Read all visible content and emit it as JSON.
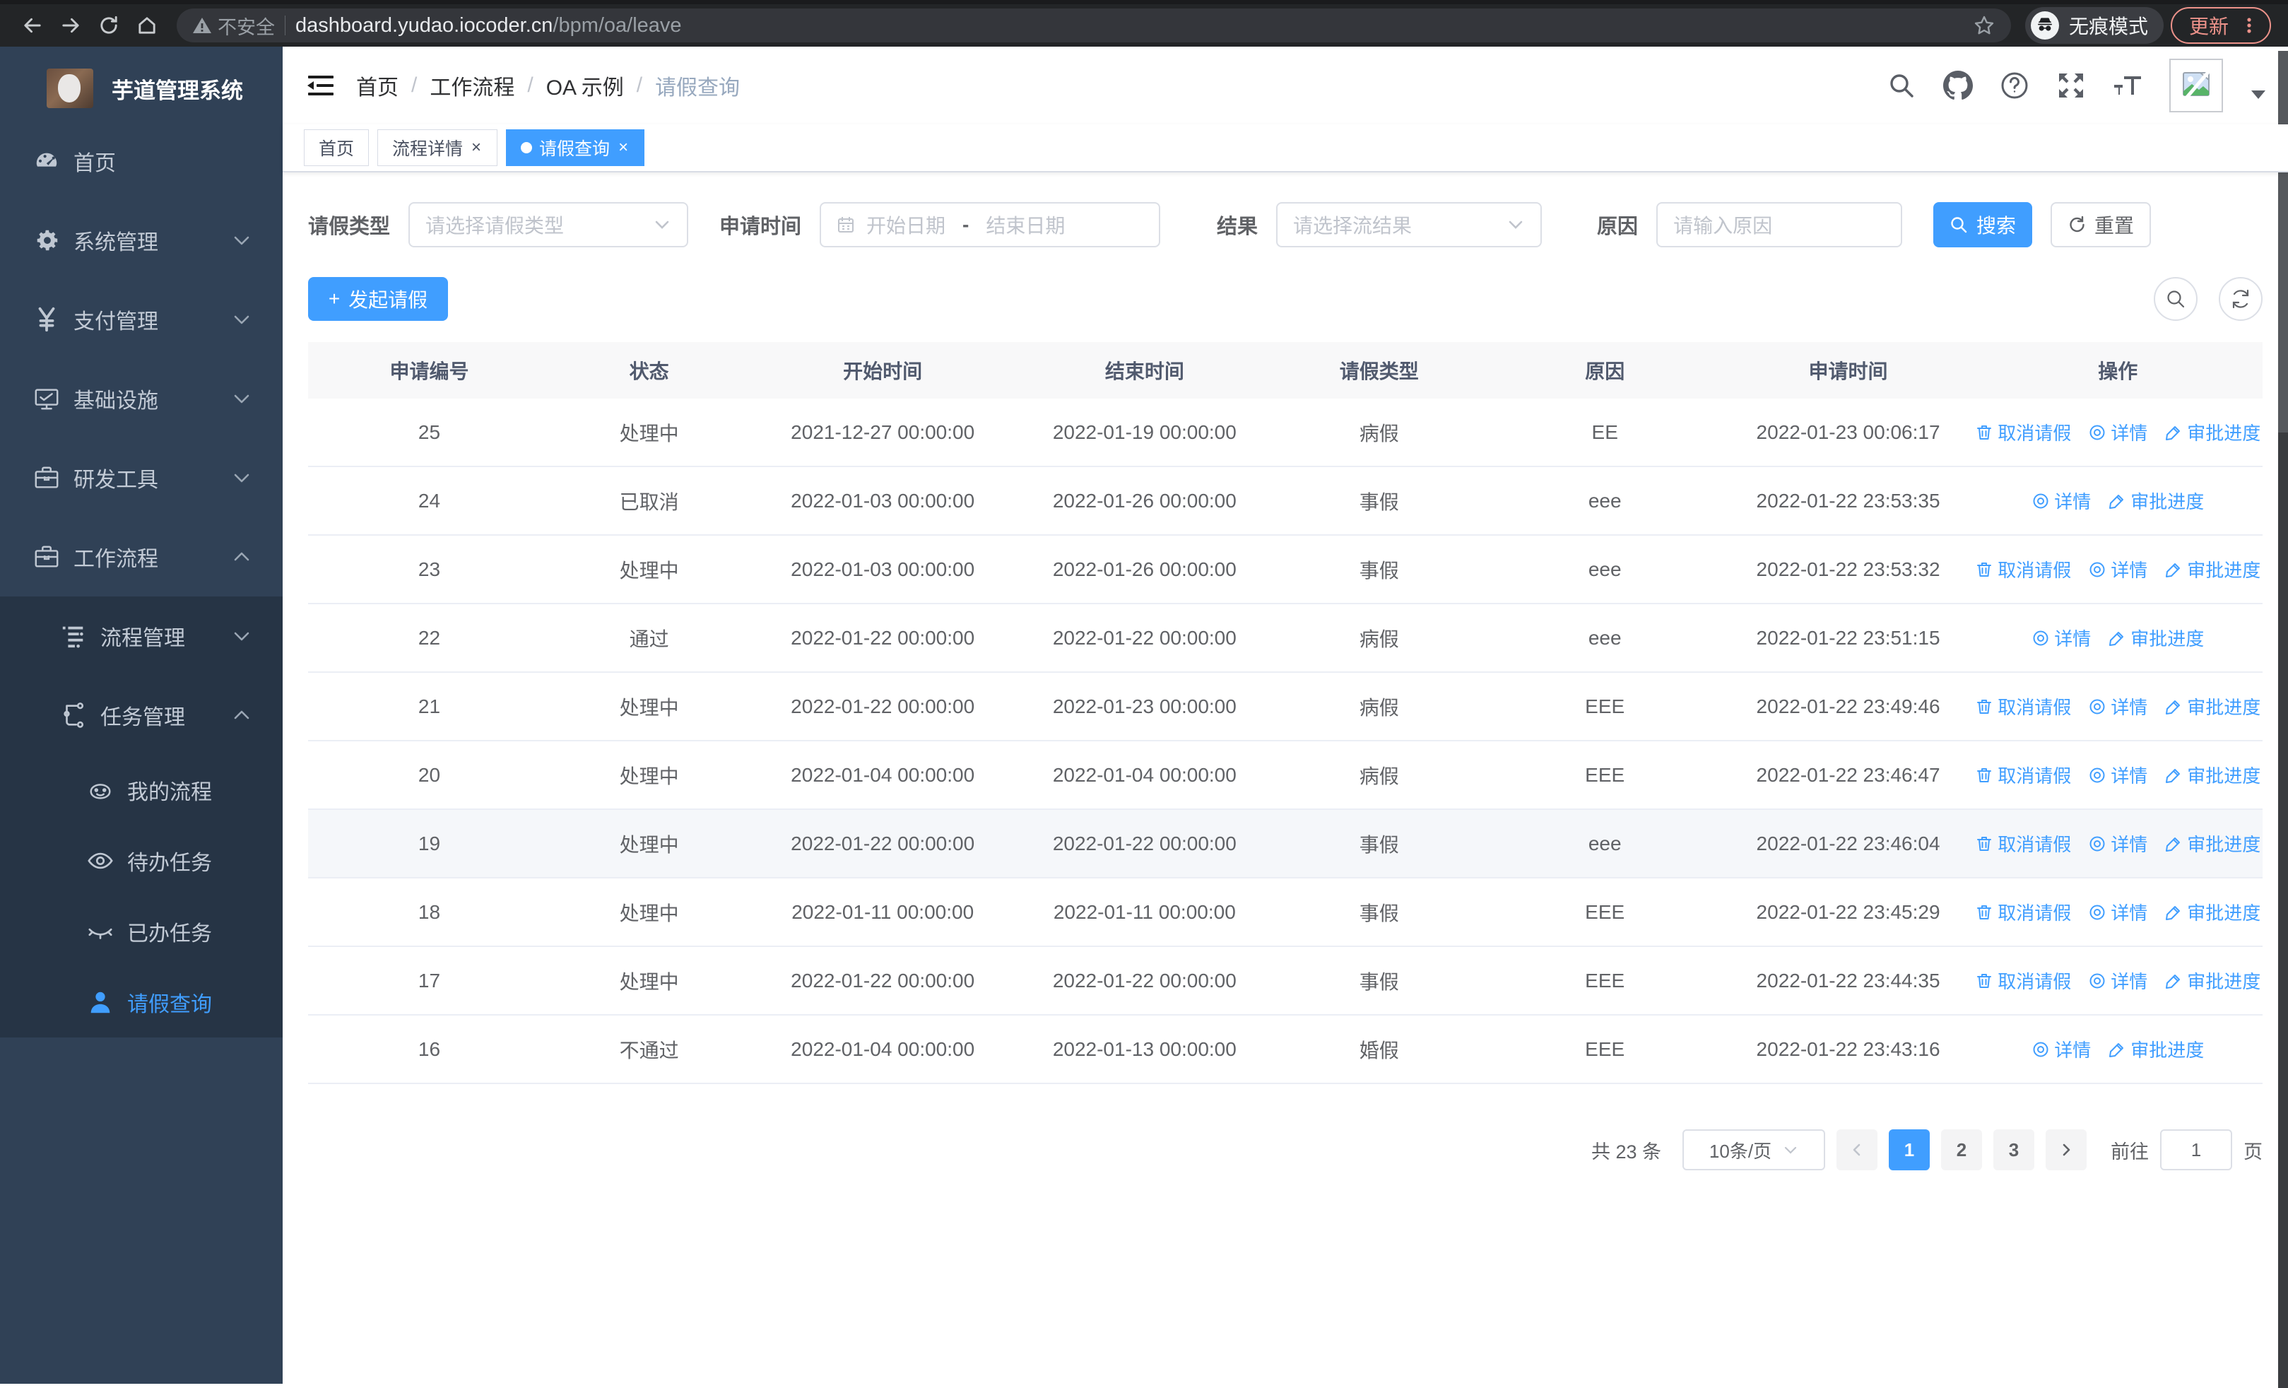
{
  "colors": {
    "accent": "#409eff",
    "sidebar_bg": "#304156",
    "submenu_bg": "#263445",
    "danger_chip": "#ec928a"
  },
  "browser": {
    "security_label": "不安全",
    "url_host": "dashboard.yudao.iocoder.cn",
    "url_path": "/bpm/oa/leave",
    "incognito_label": "无痕模式",
    "update_label": "更新"
  },
  "sidebar": {
    "title": "芋道管理系统",
    "menu": [
      {
        "name": "home",
        "label": "首页",
        "icon": "gauge",
        "level": 1,
        "arrow": "",
        "active": false
      },
      {
        "name": "system-mgmt",
        "label": "系统管理",
        "icon": "gear",
        "level": 1,
        "arrow": "down",
        "active": false
      },
      {
        "name": "payment-mgmt",
        "label": "支付管理",
        "icon": "yen",
        "level": 1,
        "arrow": "down",
        "active": false
      },
      {
        "name": "infrastructure",
        "label": "基础设施",
        "icon": "monitor",
        "level": 1,
        "arrow": "down",
        "active": false
      },
      {
        "name": "dev-tools",
        "label": "研发工具",
        "icon": "briefcase",
        "level": 1,
        "arrow": "down",
        "active": false
      },
      {
        "name": "workflow",
        "label": "工作流程",
        "icon": "briefcase",
        "level": 1,
        "arrow": "up",
        "active": false
      },
      {
        "name": "process-mgmt",
        "label": "流程管理",
        "icon": "list",
        "level": 2,
        "arrow": "down",
        "active": false
      },
      {
        "name": "task-mgmt",
        "label": "任务管理",
        "icon": "flow",
        "level": 2,
        "arrow": "up",
        "active": false
      },
      {
        "name": "my-process",
        "label": "我的流程",
        "icon": "robot",
        "level": 3,
        "arrow": "",
        "active": false
      },
      {
        "name": "todo-tasks",
        "label": "待办任务",
        "icon": "eye-open",
        "level": 3,
        "arrow": "",
        "active": false
      },
      {
        "name": "done-tasks",
        "label": "已办任务",
        "icon": "eye-closed",
        "level": 3,
        "arrow": "",
        "active": false
      },
      {
        "name": "leave-query",
        "label": "请假查询",
        "icon": "user",
        "level": 3,
        "arrow": "",
        "active": true
      }
    ]
  },
  "header": {
    "breadcrumb": [
      "首页",
      "工作流程",
      "OA 示例",
      "请假查询"
    ]
  },
  "tabs": [
    {
      "name": "home",
      "label": "首页",
      "closable": false,
      "active": false
    },
    {
      "name": "process-detail",
      "label": "流程详情",
      "closable": true,
      "active": false
    },
    {
      "name": "leave-query",
      "label": "请假查询",
      "closable": true,
      "active": true
    }
  ],
  "filters": {
    "leave_type_label": "请假类型",
    "leave_type_placeholder": "请选择请假类型",
    "apply_time_label": "申请时间",
    "start_date_placeholder": "开始日期",
    "range_separator": "-",
    "end_date_placeholder": "结束日期",
    "result_label": "结果",
    "result_placeholder": "请选择流结果",
    "reason_label": "原因",
    "reason_placeholder": "请输入原因",
    "search_label": "搜索",
    "reset_label": "重置"
  },
  "toolbar": {
    "create_label": "发起请假",
    "plus_sign": "+"
  },
  "table": {
    "columns": [
      "申请编号",
      "状态",
      "开始时间",
      "结束时间",
      "请假类型",
      "原因",
      "申请时间",
      "操作"
    ],
    "action_labels": {
      "cancel": "取消请假",
      "detail": "详情",
      "progress": "审批进度"
    },
    "rows": [
      {
        "id": "25",
        "status": "处理中",
        "start": "2021-12-27 00:00:00",
        "end": "2022-01-19 00:00:00",
        "type": "病假",
        "reason": "EE",
        "apply": "2022-01-23 00:06:17",
        "actions": [
          "cancel",
          "detail",
          "progress"
        ],
        "highlight": false
      },
      {
        "id": "24",
        "status": "已取消",
        "start": "2022-01-03 00:00:00",
        "end": "2022-01-26 00:00:00",
        "type": "事假",
        "reason": "eee",
        "apply": "2022-01-22 23:53:35",
        "actions": [
          "detail",
          "progress"
        ],
        "highlight": false
      },
      {
        "id": "23",
        "status": "处理中",
        "start": "2022-01-03 00:00:00",
        "end": "2022-01-26 00:00:00",
        "type": "事假",
        "reason": "eee",
        "apply": "2022-01-22 23:53:32",
        "actions": [
          "cancel",
          "detail",
          "progress"
        ],
        "highlight": false
      },
      {
        "id": "22",
        "status": "通过",
        "start": "2022-01-22 00:00:00",
        "end": "2022-01-22 00:00:00",
        "type": "病假",
        "reason": "eee",
        "apply": "2022-01-22 23:51:15",
        "actions": [
          "detail",
          "progress"
        ],
        "highlight": false
      },
      {
        "id": "21",
        "status": "处理中",
        "start": "2022-01-22 00:00:00",
        "end": "2022-01-23 00:00:00",
        "type": "病假",
        "reason": "EEE",
        "apply": "2022-01-22 23:49:46",
        "actions": [
          "cancel",
          "detail",
          "progress"
        ],
        "highlight": false
      },
      {
        "id": "20",
        "status": "处理中",
        "start": "2022-01-04 00:00:00",
        "end": "2022-01-04 00:00:00",
        "type": "病假",
        "reason": "EEE",
        "apply": "2022-01-22 23:46:47",
        "actions": [
          "cancel",
          "detail",
          "progress"
        ],
        "highlight": false
      },
      {
        "id": "19",
        "status": "处理中",
        "start": "2022-01-22 00:00:00",
        "end": "2022-01-22 00:00:00",
        "type": "事假",
        "reason": "eee",
        "apply": "2022-01-22 23:46:04",
        "actions": [
          "cancel",
          "detail",
          "progress"
        ],
        "highlight": true
      },
      {
        "id": "18",
        "status": "处理中",
        "start": "2022-01-11 00:00:00",
        "end": "2022-01-11 00:00:00",
        "type": "事假",
        "reason": "EEE",
        "apply": "2022-01-22 23:45:29",
        "actions": [
          "cancel",
          "detail",
          "progress"
        ],
        "highlight": false
      },
      {
        "id": "17",
        "status": "处理中",
        "start": "2022-01-22 00:00:00",
        "end": "2022-01-22 00:00:00",
        "type": "事假",
        "reason": "EEE",
        "apply": "2022-01-22 23:44:35",
        "actions": [
          "cancel",
          "detail",
          "progress"
        ],
        "highlight": false
      },
      {
        "id": "16",
        "status": "不通过",
        "start": "2022-01-04 00:00:00",
        "end": "2022-01-13 00:00:00",
        "type": "婚假",
        "reason": "EEE",
        "apply": "2022-01-22 23:43:16",
        "actions": [
          "detail",
          "progress"
        ],
        "highlight": false
      }
    ]
  },
  "pagination": {
    "total_label": "共 23 条",
    "page_size_label": "10条/页",
    "pages": [
      "1",
      "2",
      "3"
    ],
    "active_page": "1",
    "goto_label": "前往",
    "goto_value": "1",
    "page_suffix": "页"
  }
}
